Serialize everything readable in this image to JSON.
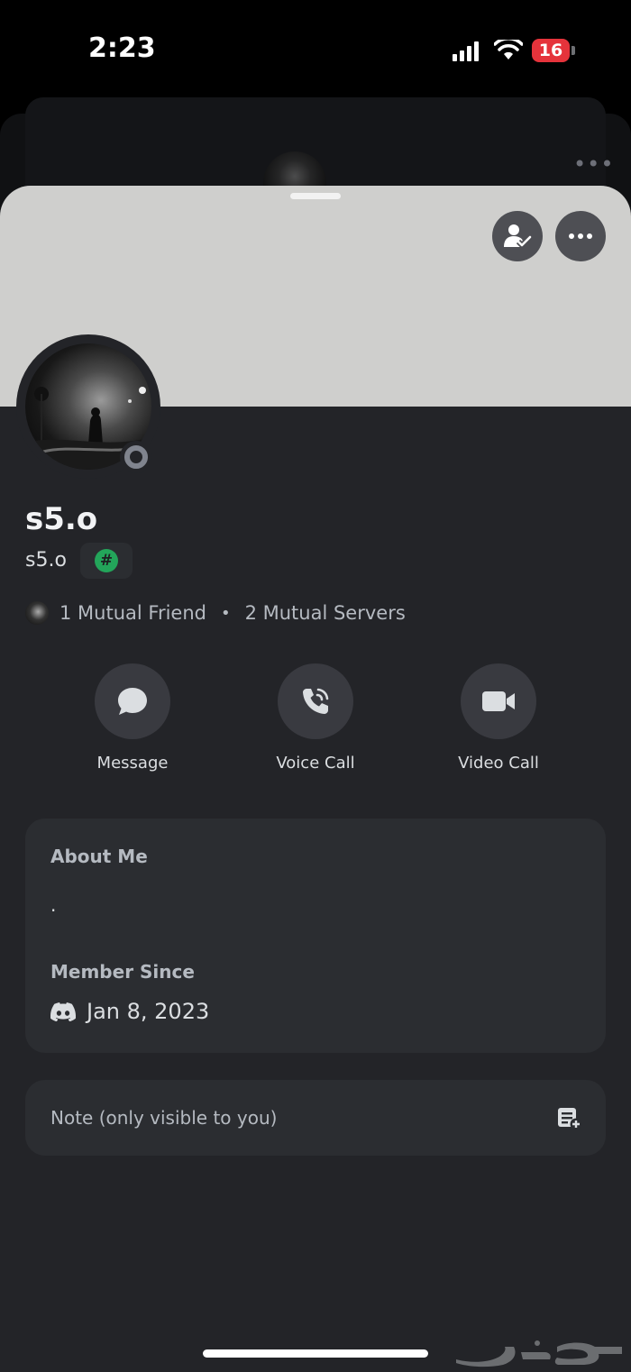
{
  "status_bar": {
    "time": "2:23",
    "battery": "16"
  },
  "profile": {
    "display_name": "s5.o",
    "username": "s5.o",
    "tag_symbol": "#",
    "mutual_friends": "1 Mutual Friend",
    "separator": "•",
    "mutual_servers": "2 Mutual Servers"
  },
  "actions": [
    {
      "label": "Message",
      "icon": "message-icon"
    },
    {
      "label": "Voice Call",
      "icon": "phone-icon"
    },
    {
      "label": "Video Call",
      "icon": "video-icon"
    }
  ],
  "about": {
    "title": "About Me",
    "text": ".",
    "member_since_title": "Member Since",
    "member_since_date": "Jan 8, 2023"
  },
  "note": {
    "placeholder": "Note (only visible to you)"
  },
  "colors": {
    "sheet_bg": "#232428",
    "banner": "#cfcfcd",
    "card_bg": "#2b2d31",
    "status_offline": "#80848e",
    "tag_green": "#23a55a",
    "battery_red": "#e5333b"
  }
}
